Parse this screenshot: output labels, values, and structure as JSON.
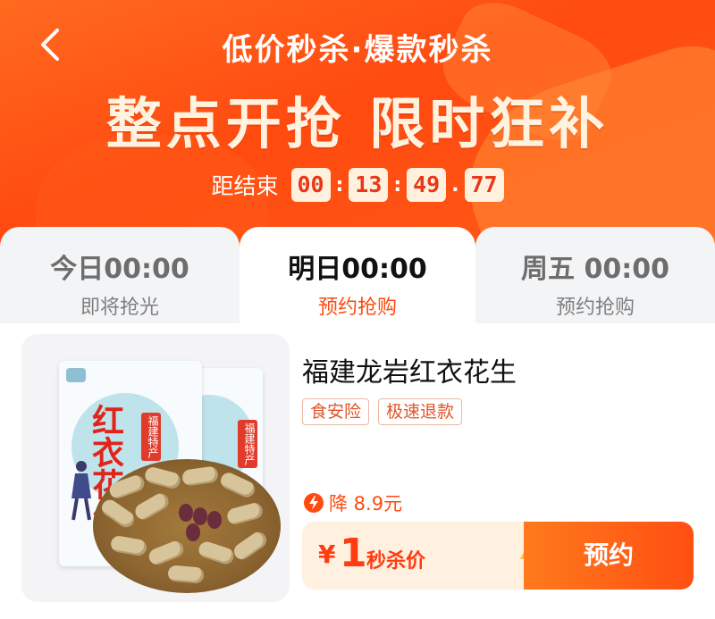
{
  "header": {
    "subtitle": "低价秒杀·爆款秒杀",
    "title": "整点开抢 限时狂补",
    "back_icon": "chevron-left-icon"
  },
  "countdown": {
    "label": "距结束",
    "hours": "00",
    "minutes": "13",
    "seconds": "49",
    "centis": "77"
  },
  "tabs": [
    {
      "time": "今日00:00",
      "status": "即将抢光"
    },
    {
      "time": "明日00:00",
      "status": "预约抢购"
    },
    {
      "time": "周五 00:00",
      "status": "预约抢购"
    }
  ],
  "product": {
    "title": "福建龙岩红衣花生",
    "badges": [
      "食安险",
      "极速退款"
    ],
    "discount": "降 8.9元",
    "price_symbol": "¥",
    "price": "1",
    "price_label": "秒杀价",
    "button": "预约",
    "bag_text": "红衣花生",
    "bag_tag": "福建特产"
  },
  "colors": {
    "accent": "#ff4a10",
    "hero": "#ff5a18",
    "countdown_box": "#fff1dd"
  }
}
